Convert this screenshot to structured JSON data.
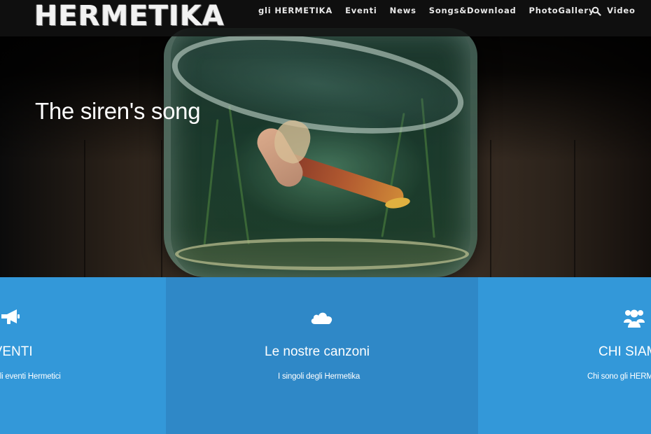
{
  "header": {
    "logo": "HERMETIKA",
    "nav": [
      {
        "label": "gli HERMETIKA"
      },
      {
        "label": "Eventi"
      },
      {
        "label": "News"
      },
      {
        "label": "Songs&Download"
      },
      {
        "label": "PhotoGallery"
      },
      {
        "label": "Video"
      }
    ],
    "search_icon": "search-icon"
  },
  "hero": {
    "title": "The siren's song"
  },
  "features": [
    {
      "icon": "megaphone-icon",
      "heading": "EVENTI",
      "text": "Tutto sugli eventi Hermetici"
    },
    {
      "icon": "cloud-icon",
      "heading": "Le nostre canzoni",
      "text": "I singoli degli Hermetika"
    },
    {
      "icon": "users-icon",
      "heading": "CHI SIAMO",
      "text": "Chi sono gli HERMETIKA"
    }
  ],
  "colors": {
    "panel_blue": "#3398d9",
    "panel_blue_dark": "#2f88c7",
    "header_bg": "#121212"
  }
}
